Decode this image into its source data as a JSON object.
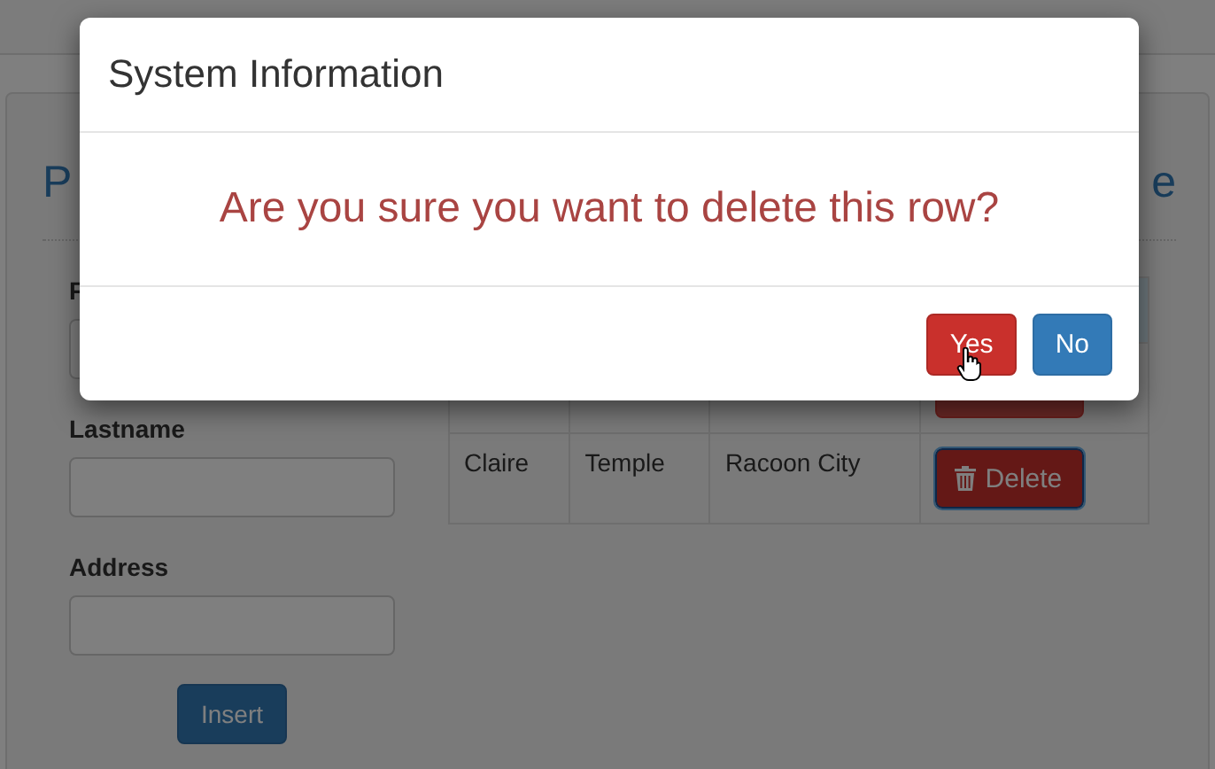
{
  "page": {
    "heading_fragments": [
      "P",
      "e"
    ],
    "form": {
      "fields": [
        {
          "label": "F"
        },
        {
          "label": "Lastname"
        },
        {
          "label": "Address"
        }
      ],
      "submit": "Insert"
    },
    "table": {
      "rows": [
        {
          "kind": "header"
        },
        {
          "kind": "covered"
        },
        {
          "kind": "data",
          "cells": [
            "Claire",
            "Temple",
            "Racoon City"
          ],
          "action": "Delete",
          "focused": true
        }
      ]
    }
  },
  "dialog": {
    "title": "System Information",
    "message": "Are you sure you want to delete this row?",
    "buttons": [
      {
        "label": "Yes",
        "kind": "danger",
        "hovered": true
      },
      {
        "label": "No",
        "kind": "primary",
        "hovered": false
      }
    ]
  }
}
